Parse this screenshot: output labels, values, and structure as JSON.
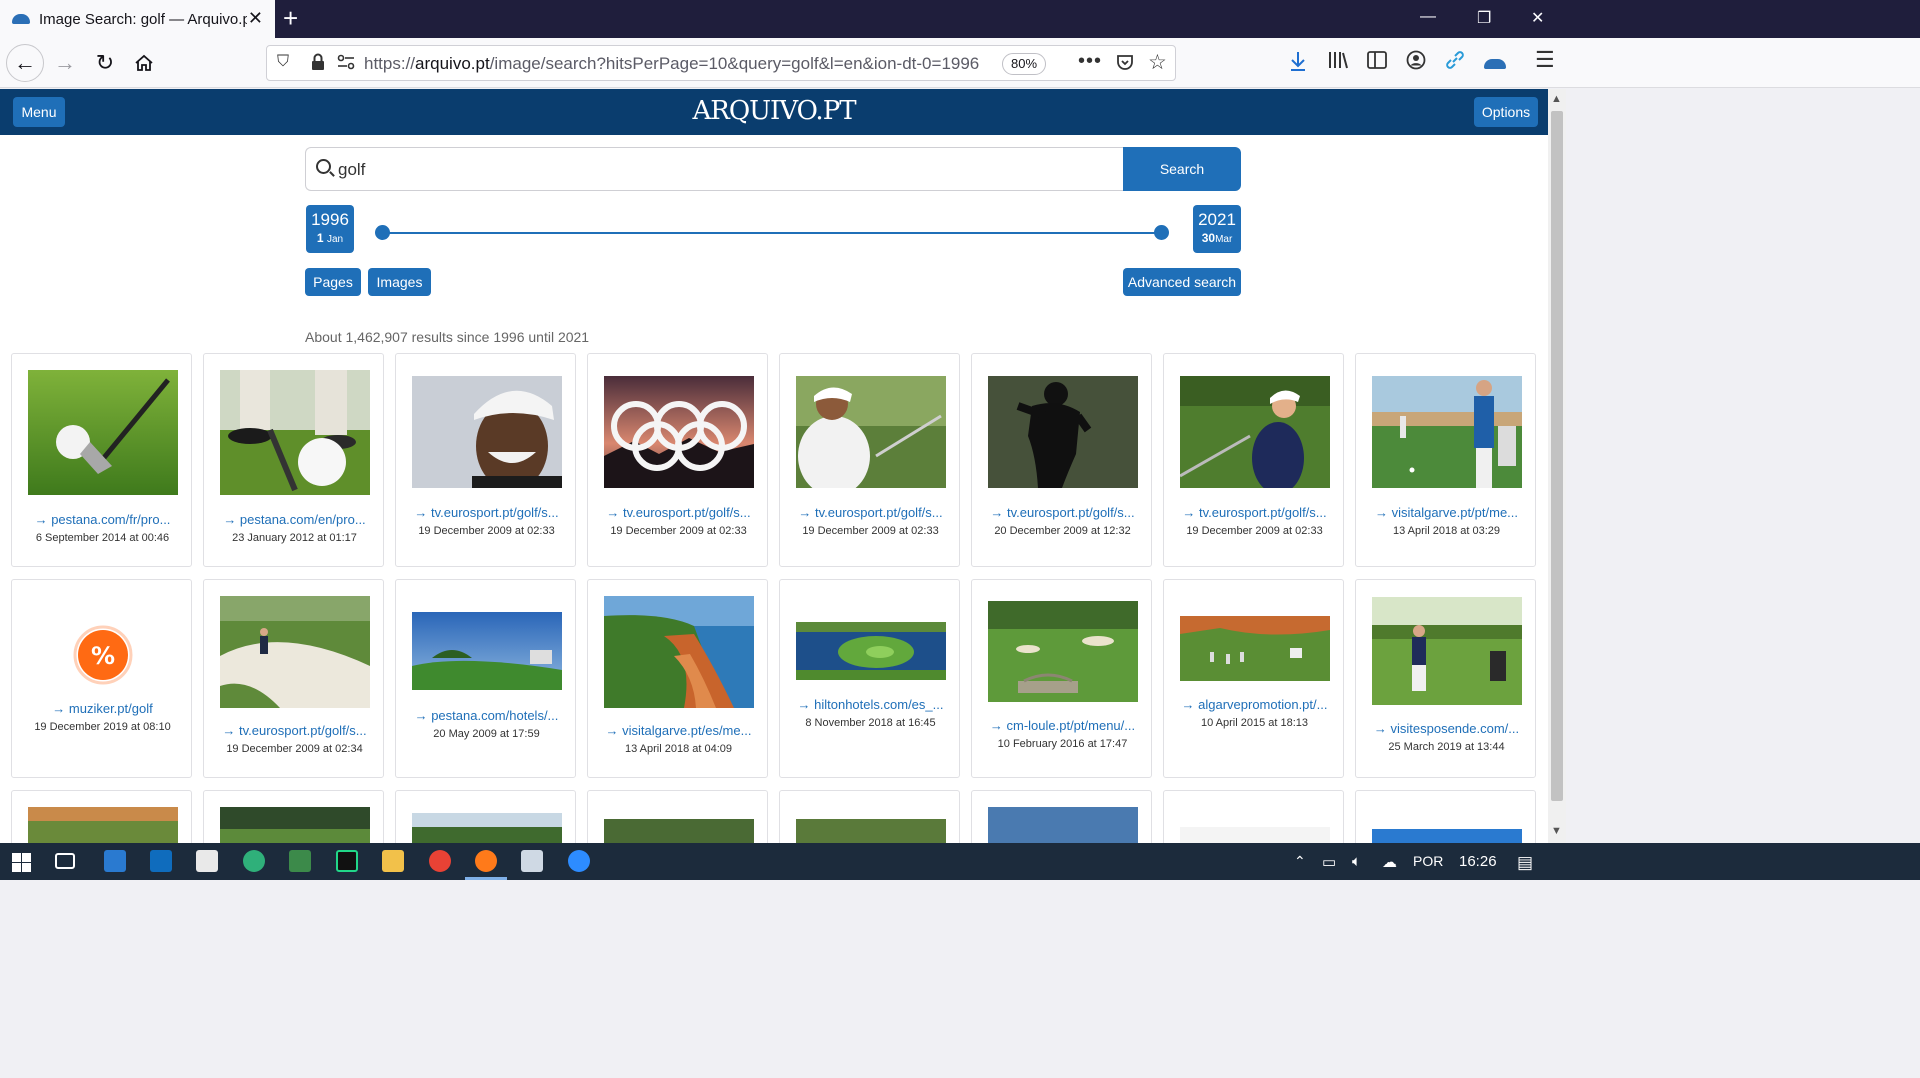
{
  "browser": {
    "tab_title": "Image Search:  golf  — Arquivo.pt",
    "new_tab": "+",
    "window_controls": {
      "minimize": "—",
      "restore": "❐",
      "close": "✕"
    },
    "url_scheme": "https://",
    "url_host": "arquivo.pt",
    "url_path": "/image/search?hitsPerPage=10&query=golf&l=en&ion-dt-0=1996",
    "zoom": "80%"
  },
  "page": {
    "menu_label": "Menu",
    "logo": "ARQUIVO.PT",
    "options_label": "Options",
    "search_value": "golf",
    "search_button": "Search",
    "date_from": {
      "year": "1996",
      "day": "1",
      "month": "Jan"
    },
    "date_to": {
      "year": "2021",
      "day": "30",
      "month": "Mar"
    },
    "pages_label": "Pages",
    "images_label": "Images",
    "advanced_label": "Advanced search",
    "results_count": "About 1,462,907 results since 1996 until 2021"
  },
  "results": [
    {
      "link": "→ pestana.com/fr/pro...",
      "date": "6 September 2014 at 00:46",
      "subject": "golf club and ball"
    },
    {
      "link": "→ pestana.com/en/pro...",
      "date": "23 January 2012 at 01:17",
      "subject": "golf ball on tee"
    },
    {
      "link": "→ tv.eurosport.pt/golf/s...",
      "date": "19 December 2009 at 02:33",
      "subject": "smiling golfer"
    },
    {
      "link": "→ tv.eurosport.pt/golf/s...",
      "date": "19 December 2009 at 02:33",
      "subject": "olympic rings"
    },
    {
      "link": "→ tv.eurosport.pt/golf/s...",
      "date": "19 December 2009 at 02:33",
      "subject": "golfer swinging"
    },
    {
      "link": "→ tv.eurosport.pt/golf/s...",
      "date": "20 December 2009 at 12:32",
      "subject": "golfer silhouette"
    },
    {
      "link": "→ tv.eurosport.pt/golf/s...",
      "date": "19 December 2009 at 02:33",
      "subject": "female golfer"
    },
    {
      "link": "→ visitalgarve.pt/pt/me...",
      "date": "13 April 2018 at 03:29",
      "subject": "golfers on coastal course"
    },
    {
      "link": "→ muziker.pt/golf",
      "date": "19 December 2019 at 08:10",
      "subject": "percent badge"
    },
    {
      "link": "→ tv.eurosport.pt/golf/s...",
      "date": "19 December 2009 at 02:34",
      "subject": "bunker shot"
    },
    {
      "link": "→ pestana.com/hotels/...",
      "date": "20 May 2009 at 17:59",
      "subject": "fairway and hotel"
    },
    {
      "link": "→ visitalgarve.pt/es/me...",
      "date": "13 April 2018 at 04:09",
      "subject": "cliff course"
    },
    {
      "link": "→ hiltonhotels.com/es_...",
      "date": "8 November 2018 at 16:45",
      "subject": "island green"
    },
    {
      "link": "→ cm-loule.pt/pt/menu/...",
      "date": "10 February 2016 at 17:47",
      "subject": "course with bridge"
    },
    {
      "link": "→ algarvepromotion.pt/...",
      "date": "10 April 2015 at 18:13",
      "subject": "golfers on green"
    },
    {
      "link": "→ visitesposende.com/...",
      "date": "25 March 2019 at 13:44",
      "subject": "golfer on course"
    }
  ],
  "taskbar": {
    "language": "POR",
    "time": "16:26"
  },
  "colors": {
    "brand": "#0a3d6e",
    "accent": "#1f6fb8",
    "link": "#1f6fb8"
  }
}
